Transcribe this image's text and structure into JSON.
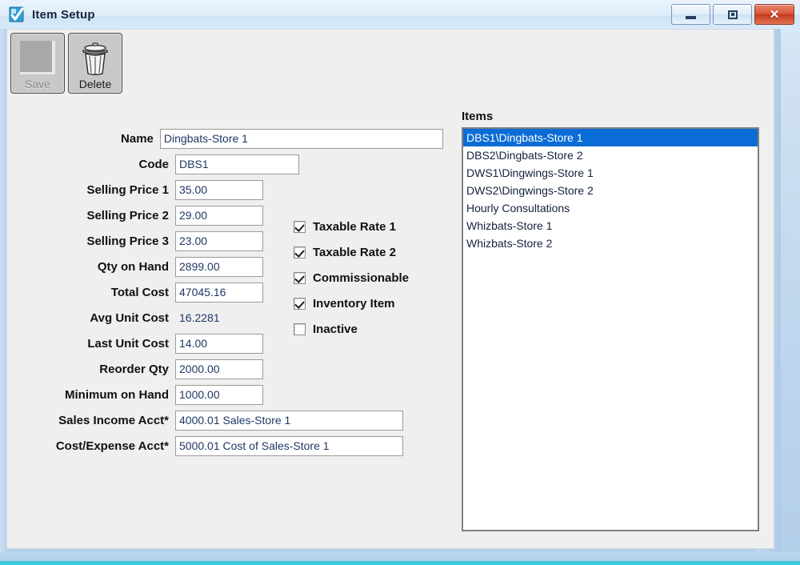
{
  "window": {
    "title": "Item Setup",
    "app_icon": "document-check-icon",
    "controls": {
      "minimize": "minimize-icon",
      "maximize": "maximize-icon",
      "close": "✕"
    },
    "accent_color": "#3ec8dd"
  },
  "toolbar": {
    "save_label": "Save",
    "save_enabled": false,
    "delete_label": "Delete",
    "delete_enabled": true
  },
  "form": {
    "fields": [
      {
        "label": "Name",
        "value": "Dingbats-Store 1",
        "width": "w-name",
        "readonly": false
      },
      {
        "label": "Code",
        "value": "DBS1",
        "width": "w-code",
        "readonly": false
      },
      {
        "label": "Selling Price 1",
        "value": "35.00",
        "width": "w-num",
        "readonly": false
      },
      {
        "label": "Selling Price 2",
        "value": "29.00",
        "width": "w-num",
        "readonly": false
      },
      {
        "label": "Selling Price 3",
        "value": "23.00",
        "width": "w-num",
        "readonly": false
      },
      {
        "label": "Qty on Hand",
        "value": "2899.00",
        "width": "w-num",
        "readonly": false
      },
      {
        "label": "Total Cost",
        "value": "47045.16",
        "width": "w-num",
        "readonly": false
      },
      {
        "label": "Avg Unit Cost",
        "value": "16.2281",
        "width": "w-num",
        "readonly": true
      },
      {
        "label": "Last Unit Cost",
        "value": "14.00",
        "width": "w-num",
        "readonly": false
      },
      {
        "label": "Reorder Qty",
        "value": "2000.00",
        "width": "w-num",
        "readonly": false
      },
      {
        "label": "Minimum on Hand",
        "value": "1000.00",
        "width": "w-num",
        "readonly": false
      },
      {
        "label": "Sales Income Acct*",
        "value": "4000.01 Sales-Store 1",
        "width": "w-acct",
        "readonly": false
      },
      {
        "label": "Cost/Expense Acct*",
        "value": "5000.01 Cost of Sales-Store 1",
        "width": "w-acct",
        "readonly": false
      }
    ]
  },
  "checkboxes": [
    {
      "label": "Taxable Rate 1",
      "checked": true
    },
    {
      "label": "Taxable Rate 2",
      "checked": true
    },
    {
      "label": "Commissionable",
      "checked": true
    },
    {
      "label": "Inventory Item",
      "checked": true
    },
    {
      "label": "Inactive",
      "checked": false
    }
  ],
  "items_panel": {
    "title": "Items",
    "selected_index": 0,
    "selection_color": "#0a6cd6",
    "items": [
      "DBS1\\Dingbats-Store 1",
      "DBS2\\Dingbats-Store 2",
      "DWS1\\Dingwings-Store 1",
      "DWS2\\Dingwings-Store 2",
      "Hourly Consultations",
      "Whizbats-Store 1",
      "Whizbats-Store 2"
    ]
  }
}
